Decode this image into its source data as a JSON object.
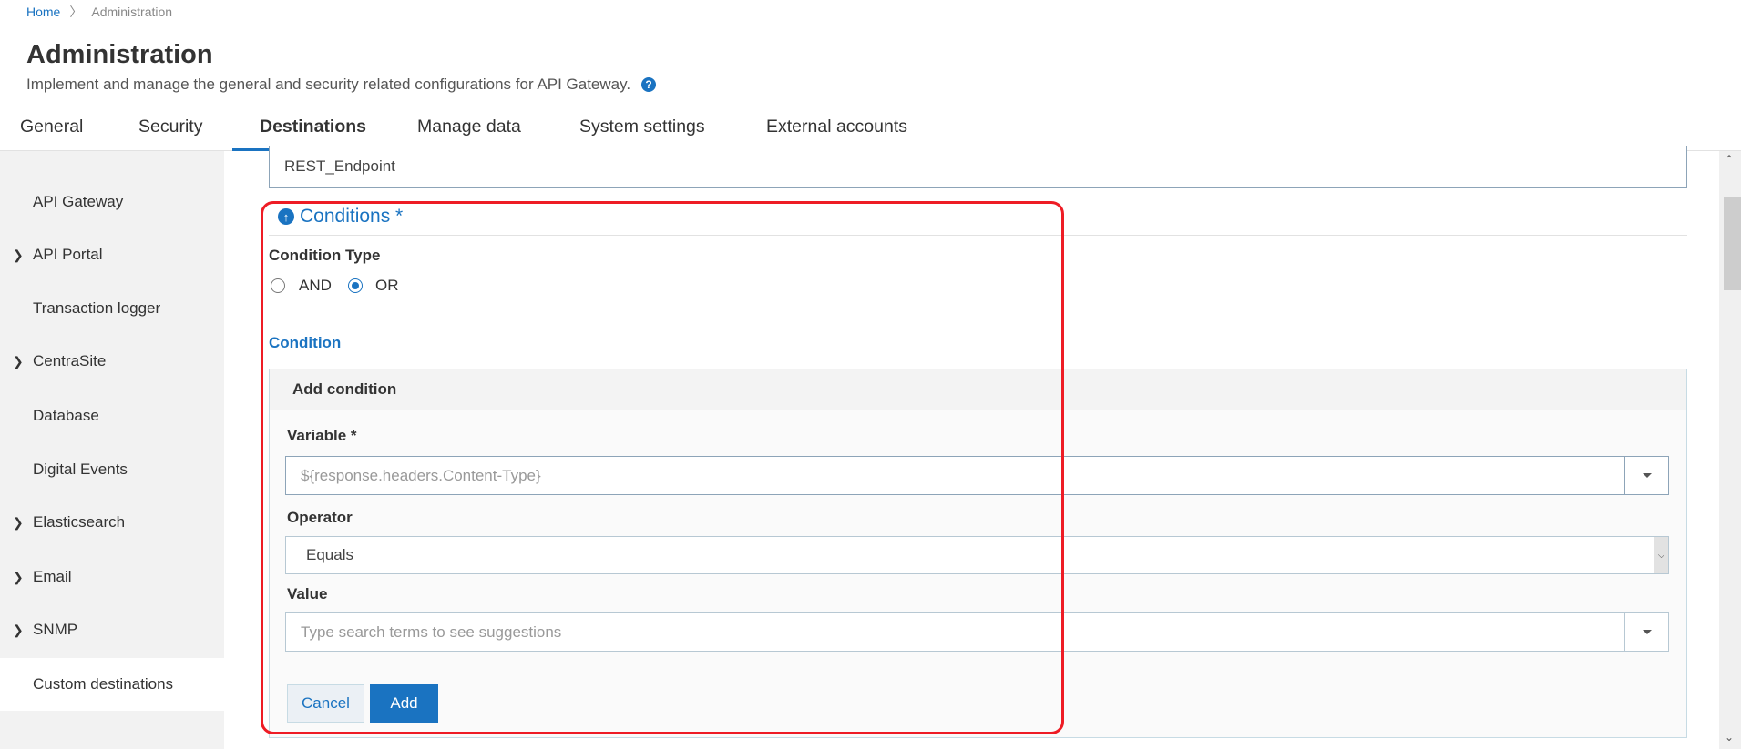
{
  "breadcrumb": {
    "home": "Home",
    "separator": "〉",
    "current": "Administration"
  },
  "header": {
    "title": "Administration",
    "subtitle": "Implement and manage the general and security related configurations for API Gateway.",
    "help_icon": "?"
  },
  "tabs": [
    {
      "label": "General"
    },
    {
      "label": "Security"
    },
    {
      "label": "Destinations",
      "active": true
    },
    {
      "label": "Manage data"
    },
    {
      "label": "System settings"
    },
    {
      "label": "External accounts"
    }
  ],
  "sidebar": {
    "items": [
      {
        "label": "API Gateway",
        "expandable": false
      },
      {
        "label": "API Portal",
        "expandable": true
      },
      {
        "label": "Transaction logger",
        "expandable": false
      },
      {
        "label": "CentraSite",
        "expandable": true
      },
      {
        "label": "Database",
        "expandable": false
      },
      {
        "label": "Digital Events",
        "expandable": false
      },
      {
        "label": "Elasticsearch",
        "expandable": true
      },
      {
        "label": "Email",
        "expandable": true
      },
      {
        "label": "SNMP",
        "expandable": true
      },
      {
        "label": "Custom destinations",
        "expandable": false,
        "selected": true
      }
    ]
  },
  "form": {
    "endpoint_value": "REST_Endpoint",
    "conditions_title": "Conditions *",
    "condition_type_label": "Condition Type",
    "radio_and": "AND",
    "radio_or": "OR",
    "selected_type": "OR",
    "condition_label": "Condition",
    "add_condition": {
      "title": "Add condition",
      "variable_label": "Variable *",
      "variable_placeholder": "${response.headers.Content-Type}",
      "operator_label": "Operator",
      "operator_value": "Equals",
      "value_label": "Value",
      "value_placeholder": "Type search terms to see suggestions",
      "cancel": "Cancel",
      "add": "Add"
    }
  },
  "colors": {
    "accent": "#1a73c1",
    "highlight": "#ee1c25"
  }
}
